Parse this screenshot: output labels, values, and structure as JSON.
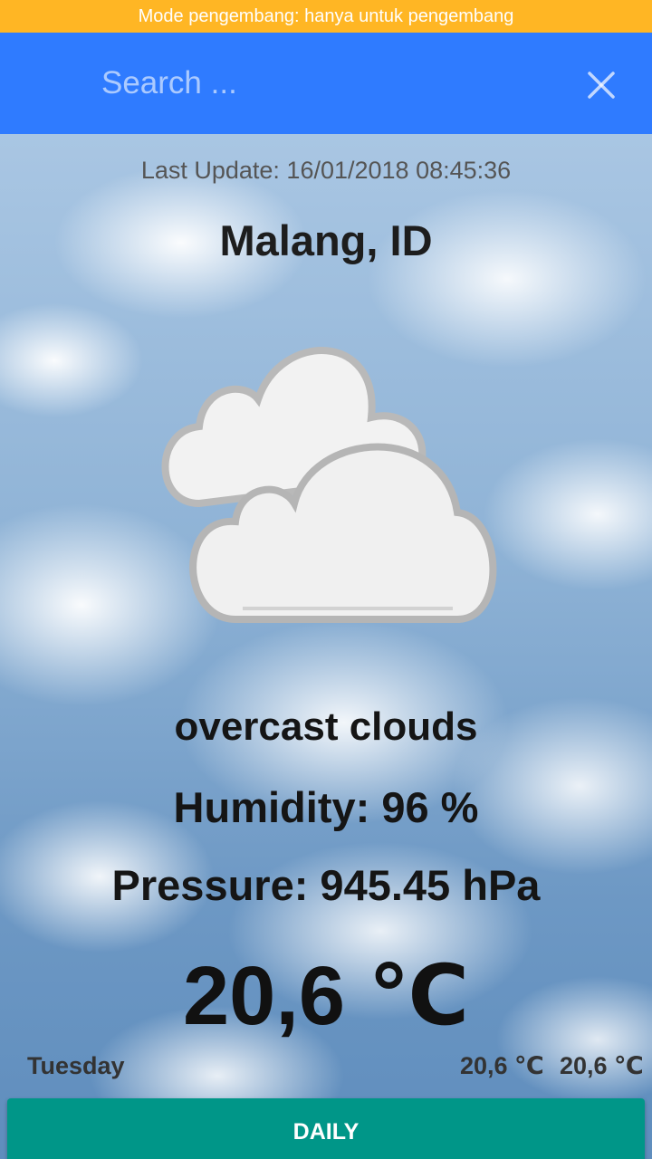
{
  "status_bar": {
    "text": "Mode pengembang: hanya untuk pengembang"
  },
  "search": {
    "placeholder": "Search ..."
  },
  "icons": {
    "close": "close-icon",
    "weather": "overcast-clouds-icon"
  },
  "weather": {
    "last_update": "Last Update: 16/01/2018 08:45:36",
    "city": "Malang, ID",
    "description": "overcast clouds",
    "humidity": "Humidity: 96 %",
    "pressure": "Pressure: 945.45 hPa",
    "temperature": "20,6 ℃"
  },
  "forecast": [
    {
      "day": "Tuesday",
      "min": "20,6 ℃",
      "max": "20,6 ℃"
    }
  ],
  "buttons": {
    "daily": "DAILY"
  },
  "colors": {
    "status_bar": "#ffb624",
    "search_bar": "#2f7bff",
    "daily_button": "#009688"
  }
}
